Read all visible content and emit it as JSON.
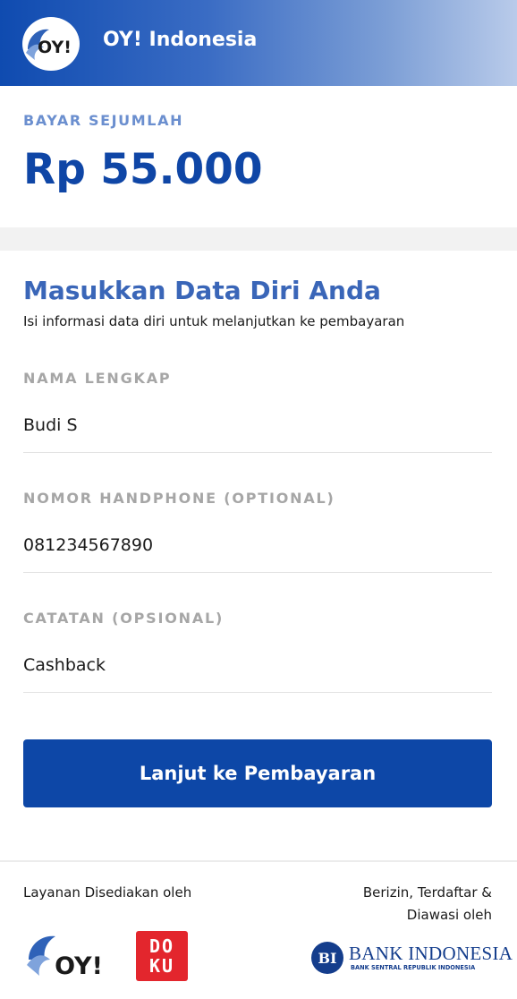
{
  "header": {
    "logo_text": "OY!",
    "title": "OY! Indonesia"
  },
  "payment": {
    "label": "BAYAR SEJUMLAH",
    "amount": "Rp 55.000"
  },
  "form": {
    "title": "Masukkan Data Diri Anda",
    "subtitle": "Isi informasi data diri untuk melanjutkan ke pembayaran",
    "fields": [
      {
        "label": "NAMA LENGKAP",
        "value": "Budi S"
      },
      {
        "label": "NOMOR HANDPHONE (OPTIONAL)",
        "value": "081234567890"
      },
      {
        "label": "CATATAN (OPSIONAL)",
        "value": "Cashback"
      }
    ],
    "submit_label": "Lanjut ke Pembayaran"
  },
  "footer": {
    "provided_by": "Layanan Disediakan oleh",
    "regulated_by": "Berizin, Terdaftar & Diawasi oleh",
    "oy_logo_text": "OY!",
    "doku_logo_text": [
      "DO",
      "KU"
    ],
    "bi_logo_name": "BANK INDONESIA",
    "bi_logo_sub": "BANK SENTRAL REPUBLIK INDONESIA"
  },
  "colors": {
    "primary": "#0d47a7",
    "header_gradient_start": "#0f4bb0",
    "header_gradient_end": "#b9cbea",
    "title_blue": "#3a66b8",
    "doku_red": "#e3262d"
  }
}
